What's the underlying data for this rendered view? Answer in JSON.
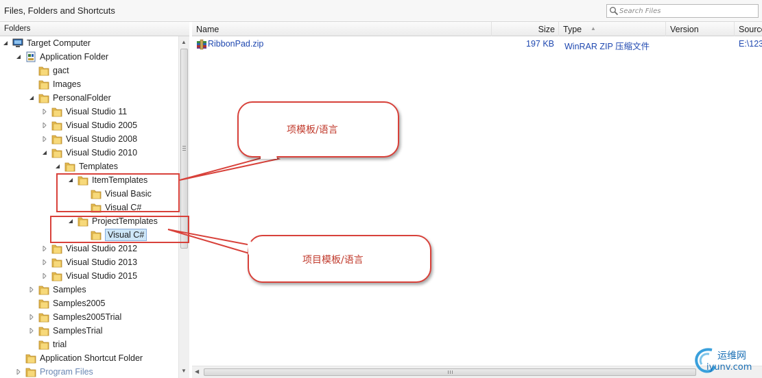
{
  "window": {
    "title": "Files, Folders and Shortcuts"
  },
  "search": {
    "placeholder": "Search Files",
    "icon": "search-icon"
  },
  "folders_panel": {
    "header": "Folders",
    "tree": [
      {
        "label": "Target Computer",
        "icon": "computer-icon",
        "expander": "expanded"
      },
      {
        "label": "Application Folder",
        "icon": "app-folder-icon",
        "expander": "expanded"
      },
      {
        "label": "gact",
        "icon": "folder-icon",
        "expander": "none"
      },
      {
        "label": "Images",
        "icon": "folder-icon",
        "expander": "none"
      },
      {
        "label": "PersonalFolder",
        "icon": "folder-icon",
        "expander": "expanded"
      },
      {
        "label": "Visual Studio 11",
        "icon": "folder-icon",
        "expander": "collapsed"
      },
      {
        "label": "Visual Studio 2005",
        "icon": "folder-icon",
        "expander": "collapsed"
      },
      {
        "label": "Visual Studio 2008",
        "icon": "folder-icon",
        "expander": "collapsed"
      },
      {
        "label": "Visual Studio 2010",
        "icon": "folder-icon",
        "expander": "expanded"
      },
      {
        "label": "Templates",
        "icon": "folder-icon",
        "expander": "expanded"
      },
      {
        "label": "ItemTemplates",
        "icon": "folder-icon",
        "expander": "expanded"
      },
      {
        "label": "Visual Basic",
        "icon": "folder-icon",
        "expander": "none"
      },
      {
        "label": "Visual C#",
        "icon": "folder-icon",
        "expander": "none"
      },
      {
        "label": "ProjectTemplates",
        "icon": "folder-icon",
        "expander": "expanded"
      },
      {
        "label": "Visual C#",
        "icon": "folder-icon",
        "expander": "none",
        "selected": true
      },
      {
        "label": "Visual Studio 2012",
        "icon": "folder-icon",
        "expander": "collapsed"
      },
      {
        "label": "Visual Studio 2013",
        "icon": "folder-icon",
        "expander": "collapsed"
      },
      {
        "label": "Visual Studio 2015",
        "icon": "folder-icon",
        "expander": "collapsed"
      },
      {
        "label": "Samples",
        "icon": "folder-icon",
        "expander": "collapsed"
      },
      {
        "label": "Samples2005",
        "icon": "folder-icon",
        "expander": "none"
      },
      {
        "label": "Samples2005Trial",
        "icon": "folder-icon",
        "expander": "collapsed"
      },
      {
        "label": "SamplesTrial",
        "icon": "folder-icon",
        "expander": "collapsed"
      },
      {
        "label": "trial",
        "icon": "folder-icon",
        "expander": "none"
      },
      {
        "label": "Application Shortcut Folder",
        "icon": "folder-icon",
        "expander": "none"
      },
      {
        "label": "Program Files",
        "icon": "folder-icon",
        "expander": "collapsed",
        "dimmed": true
      }
    ]
  },
  "file_list": {
    "columns": [
      "Name",
      "Size",
      "Type",
      "Version",
      "Source"
    ],
    "sort_column": "Type",
    "sort_direction": "ascending",
    "rows": [
      {
        "name": "RibbonPad.zip",
        "size": "197 KB",
        "type": "WinRAR ZIP 压缩文件",
        "version": "",
        "source": "E:\\123",
        "icon": "zip-archive-icon"
      }
    ]
  },
  "annotations": {
    "callout_item": "项模板/语言",
    "callout_project": "项目模板/语言",
    "color": "#d8413a"
  },
  "watermark": {
    "text_cn": "运维网",
    "text_en": "iyunv.com",
    "color": "#1a6fb5"
  }
}
